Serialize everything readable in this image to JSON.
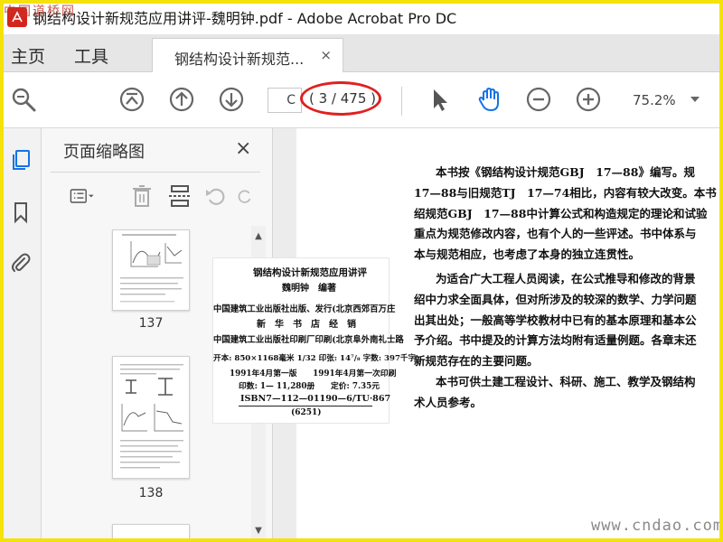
{
  "window": {
    "title": "钢结构设计新规范应用讲评-魏明钟.pdf - Adobe Acrobat Pro DC",
    "watermark_top_left": "中国道桥网"
  },
  "menu": {
    "items": [
      "主页",
      "工具"
    ]
  },
  "tab": {
    "label": "钢结构设计新规范...",
    "close": "×"
  },
  "toolbar": {
    "page_input_value": "C",
    "page_count": "( 3 / 475 )",
    "zoom_value": "75.2%",
    "icons": [
      "zoom-search-icon",
      "first-page-icon",
      "prev-page-icon",
      "next-page-icon",
      "select-arrow-icon",
      "hand-icon",
      "zoom-out-icon",
      "zoom-in-icon"
    ],
    "annotation_color": "#e02020"
  },
  "panel": {
    "title": "页面缩略图",
    "close": "×",
    "thumbnails": [
      {
        "label": "137"
      },
      {
        "label": "138"
      }
    ]
  },
  "copyright_page": {
    "lines": [
      "钢结构设计新规范应用讲评",
      "魏明钟　编著",
      "中国建筑工业出版社出版、发行(北京西郊百万庄",
      "新　华　书　店　经　销",
      "中国建筑工业出版社印刷厂印刷(北京阜外南礼士路",
      "开本: 850×1168毫米 1/32 印张: 14⁷/₈ 字数: 397千字",
      "1991年4月第一版　　1991年4月第一次印刷",
      "印数: 1— 11,280册　　定价: 7.35元",
      "ISBN7—112—01190—6/TU·867",
      "(6251)"
    ]
  },
  "document": {
    "paragraphs": [
      "本书按《钢结构设计规范GBJ　17—88》编写。规",
      "17—88与旧规范TJ　17—74相比，内容有较大改变。本书",
      "绍规范GBJ　17—88中计算公式和构造规定的理论和试验",
      "重点为规范修改内容，也有个人的一些评述。书中体系与",
      "本与规范相应，也考虑了本身的独立连贯性。",
      "为适合广大工程人员阅读，在公式推导和修改的背景",
      "绍中力求全面具体，但对所涉及的较深的数学、力学问题",
      "出其出处；一般高等学校教材中已有的基本原理和基本公",
      "予介绍。书中提及的计算方法均附有适量例题。各章末还",
      "新规范存在的主要问题。",
      "本书可供土建工程设计、科研、施工、教学及钢结构",
      "术人员参考。"
    ],
    "watermark_bottom_right": "www.cndao.com"
  }
}
